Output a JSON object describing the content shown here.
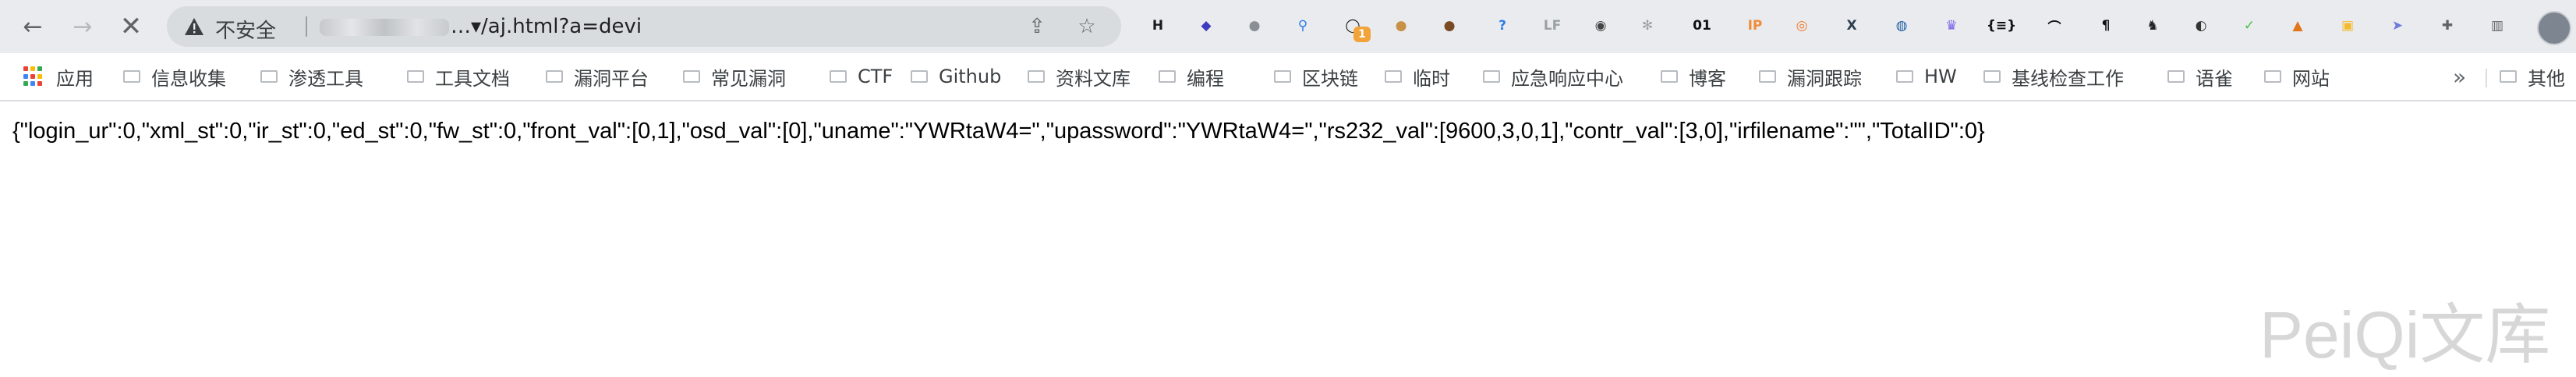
{
  "browser": {
    "omnibox": {
      "security_label": "不安全",
      "url_visible": "…▾/aj.html?a=devi"
    },
    "extensions": [
      {
        "icon": "h-icon",
        "text": "H",
        "color": "#1a1a1a"
      },
      {
        "icon": "stack-icon",
        "text": "◆",
        "color": "#3f3bbf"
      },
      {
        "icon": "grey-circle-icon",
        "text": "●",
        "color": "#8a8f96"
      },
      {
        "icon": "pin-icon",
        "text": "⚲",
        "color": "#2b7de9"
      },
      {
        "icon": "ring-icon",
        "text": "◯",
        "color": "#111111",
        "badge": "1"
      },
      {
        "icon": "cookie-icon",
        "text": "●",
        "color": "#c89145"
      },
      {
        "icon": "cookie-dark-icon",
        "text": "●",
        "color": "#7a4a23"
      },
      {
        "icon": "question-icon",
        "text": "?",
        "color": "#2b7de9"
      },
      {
        "icon": "lf-icon",
        "text": "LF",
        "color": "#9aa0a6"
      },
      {
        "icon": "mask-icon",
        "text": "◉",
        "color": "#444444"
      },
      {
        "icon": "gear-grey-icon",
        "text": "✻",
        "color": "#9aa0a6"
      },
      {
        "icon": "binary-icon",
        "text": "01",
        "color": "#111111"
      },
      {
        "icon": "ip-icon",
        "text": "IP",
        "color": "#f08c3a"
      },
      {
        "icon": "orange-target-icon",
        "text": "◎",
        "color": "#f07a2a"
      },
      {
        "icon": "x-icon",
        "text": "X",
        "color": "#2c3e50"
      },
      {
        "icon": "camera-icon",
        "text": "◍",
        "color": "#1f5fa8"
      },
      {
        "icon": "purple-crown-icon",
        "text": "♛",
        "color": "#7b61e8"
      },
      {
        "icon": "braces-icon",
        "text": "{≡}",
        "color": "#111111"
      },
      {
        "icon": "hat-icon",
        "text": "⌒",
        "color": "#111111"
      },
      {
        "icon": "pilcrow-icon",
        "text": "¶",
        "color": "#111111"
      },
      {
        "icon": "hacker-icon",
        "text": "♞",
        "color": "#222222"
      },
      {
        "icon": "panda-icon",
        "text": "◐",
        "color": "#333333"
      },
      {
        "icon": "green-check-icon",
        "text": "✓",
        "color": "#4cc04c"
      },
      {
        "icon": "fox-icon",
        "text": "▲",
        "color": "#e2761b"
      },
      {
        "icon": "yellow-cube-icon",
        "text": "▣",
        "color": "#f3ba2f"
      },
      {
        "icon": "bird-icon",
        "text": "➤",
        "color": "#6b7bd8"
      },
      {
        "icon": "puzzle-icon",
        "text": "✚",
        "color": "#5f6368"
      },
      {
        "icon": "sidebar-icon",
        "text": "▥",
        "color": "#5f6368"
      }
    ]
  },
  "bookmarks": {
    "apps_label": "应用",
    "items": [
      "信息收集",
      "渗透工具",
      "工具文档",
      "漏洞平台",
      "常见漏洞",
      "CTF",
      "Github",
      "资料文库",
      "编程",
      "区块链",
      "临时",
      "应急响应中心",
      "博客",
      "漏洞跟踪",
      "HW",
      "基线检查工作",
      "语雀",
      "网站"
    ],
    "overflow_label": "»",
    "other_label": "其他"
  },
  "page": {
    "json_response": "{\"login_ur\":0,\"xml_st\":0,\"ir_st\":0,\"ed_st\":0,\"fw_st\":0,\"front_val\":[0,1],\"osd_val\":[0],\"uname\":\"YWRtaW4=\",\"upassword\":\"YWRtaW4=\",\"rs232_val\":[9600,3,0,1],\"contr_val\":[3,0],\"irfilename\":\"\",\"TotalID\":0}",
    "watermark": "PeiQi文库"
  }
}
